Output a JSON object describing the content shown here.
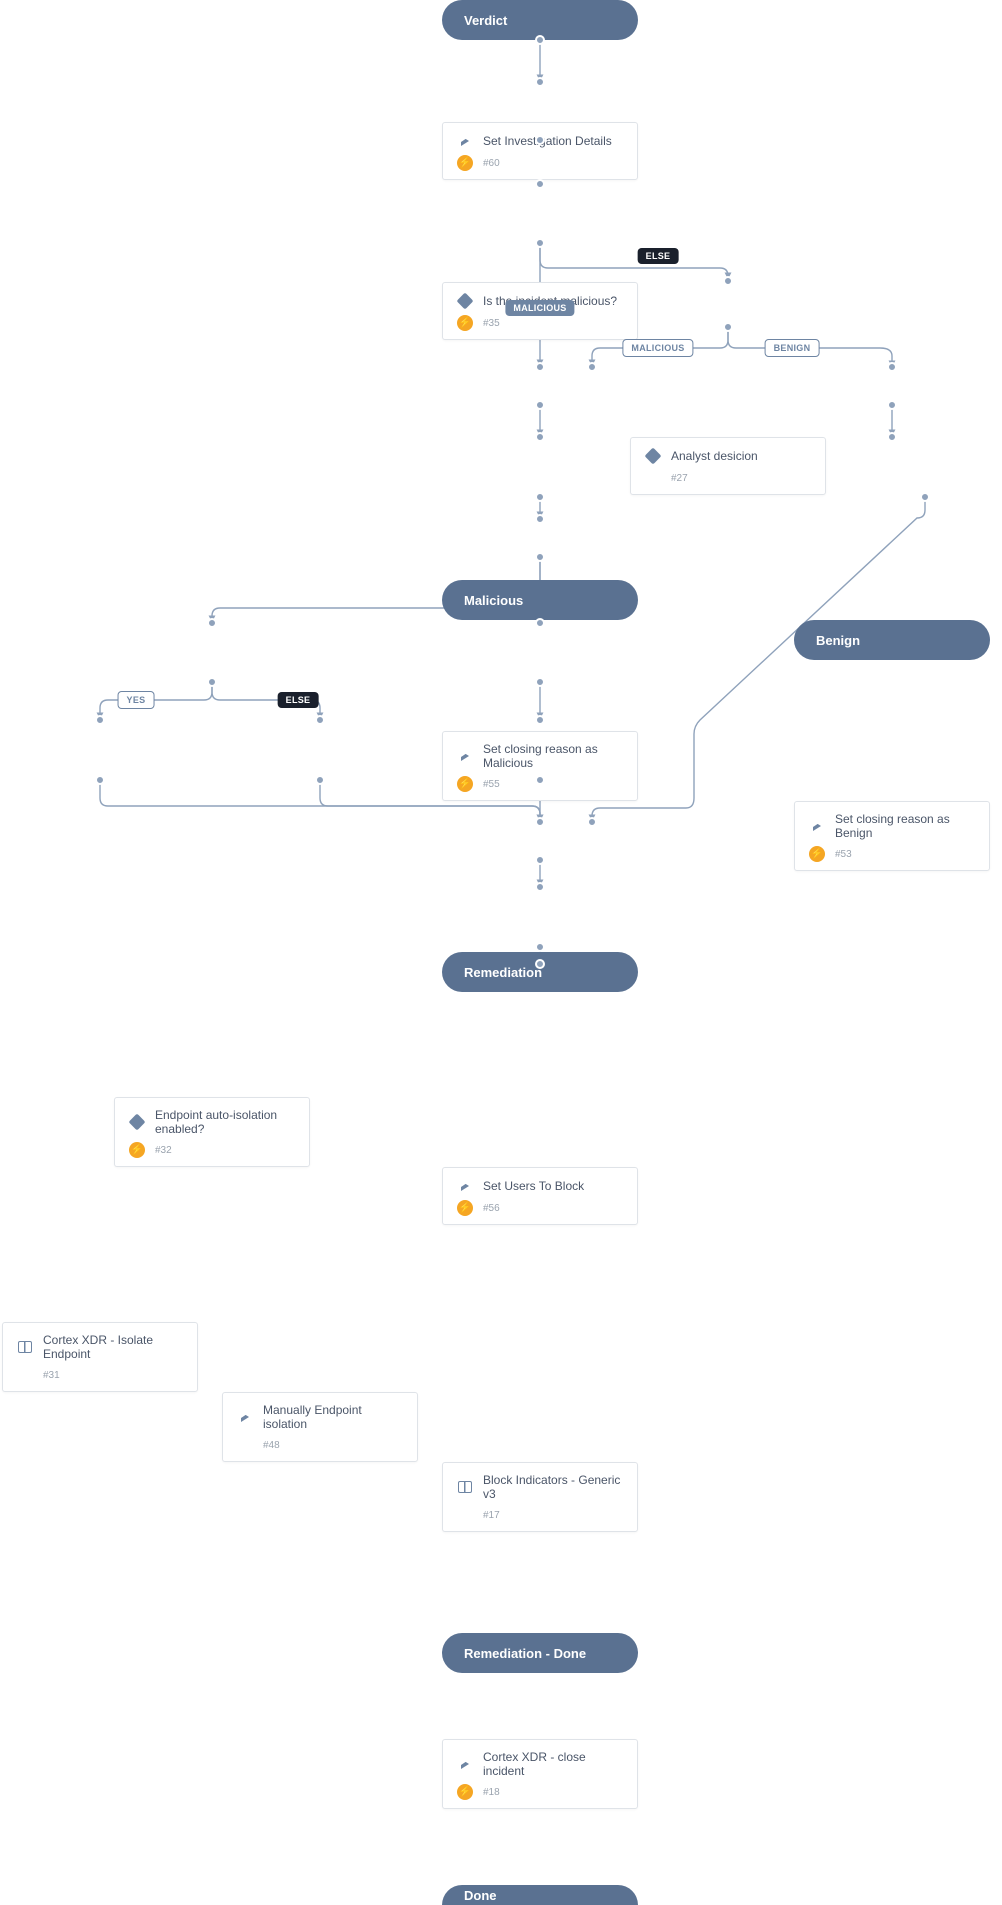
{
  "nodes": {
    "verdict": {
      "label": "Verdict"
    },
    "set_inv": {
      "label": "Set Investigation Details",
      "id": "#60"
    },
    "is_malicious": {
      "label": "Is the incident malicious?",
      "id": "#35"
    },
    "analyst": {
      "label": "Analyst desicion",
      "id": "#27"
    },
    "malicious_hdr": {
      "label": "Malicious"
    },
    "benign_hdr": {
      "label": "Benign"
    },
    "close_malicious": {
      "label": "Set closing reason as Malicious",
      "id": "#55"
    },
    "close_benign": {
      "label": "Set closing reason as Benign",
      "id": "#53"
    },
    "remediation": {
      "label": "Remediation"
    },
    "auto_iso": {
      "label": "Endpoint auto-isolation enabled?",
      "id": "#32"
    },
    "set_users": {
      "label": "Set Users To Block",
      "id": "#56"
    },
    "isolate": {
      "label": "Cortex XDR - Isolate Endpoint",
      "id": "#31"
    },
    "manual": {
      "label": "Manually Endpoint isolation",
      "id": "#48"
    },
    "block": {
      "label": "Block Indicators - Generic v3",
      "id": "#17"
    },
    "rem_done": {
      "label": "Remediation - Done"
    },
    "close_inc": {
      "label": "Cortex XDR - close incident",
      "id": "#18"
    },
    "done": {
      "label": "Done"
    }
  },
  "edges": {
    "malicious1": "MALICIOUS",
    "else1": "ELSE",
    "malicious2": "MALICIOUS",
    "benign": "BENIGN",
    "yes": "YES",
    "else2": "ELSE"
  }
}
